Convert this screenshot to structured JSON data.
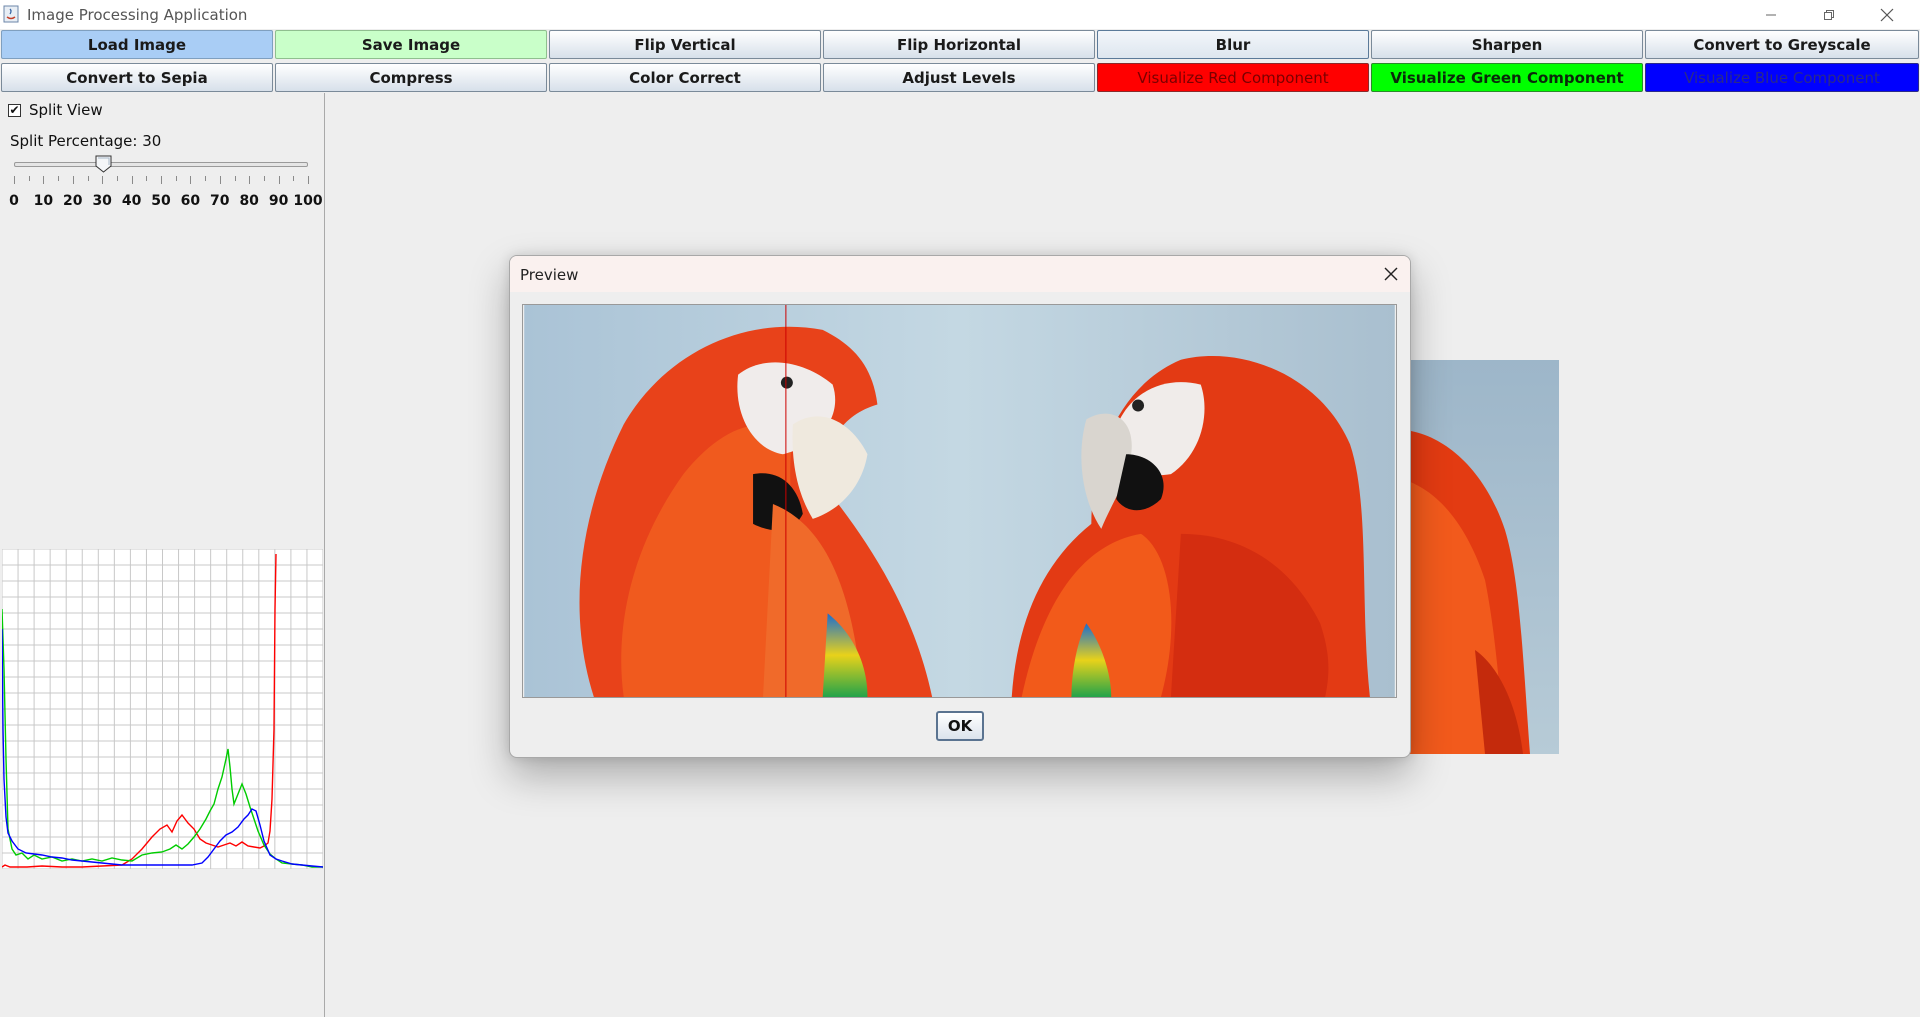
{
  "window": {
    "title": "Image Processing Application",
    "icons": [
      "java-app-icon",
      "minimize-icon",
      "restore-icon",
      "close-icon"
    ]
  },
  "toolbar": {
    "row1": [
      {
        "label": "Load Image",
        "style": "load",
        "color": "#a9cdf5"
      },
      {
        "label": "Save Image",
        "style": "save",
        "color": "#c9ffc9"
      },
      {
        "label": "Flip Vertical",
        "style": "default"
      },
      {
        "label": "Flip Horizontal",
        "style": "default"
      },
      {
        "label": "Blur",
        "style": "selected"
      },
      {
        "label": "Sharpen",
        "style": "default"
      },
      {
        "label": "Convert to Greyscale",
        "style": "default"
      }
    ],
    "row2": [
      {
        "label": "Convert to Sepia",
        "style": "default"
      },
      {
        "label": "Compress",
        "style": "default"
      },
      {
        "label": "Color Correct",
        "style": "default"
      },
      {
        "label": "Adjust Levels",
        "style": "default"
      },
      {
        "label": "Visualize Red Component",
        "style": "red",
        "color": "#ff0000"
      },
      {
        "label": "Visualize Green Component",
        "style": "green",
        "color": "#00ff00"
      },
      {
        "label": "Visualize Blue Component",
        "style": "blue",
        "color": "#0000ff"
      }
    ]
  },
  "left_panel": {
    "split_view": {
      "label": "Split View",
      "checked": true,
      "check_glyph": "✔"
    },
    "split_percentage": {
      "label": "Split Percentage:",
      "value": "30"
    },
    "slider": {
      "value": 30,
      "min": 0,
      "max": 100
    },
    "tick_labels": [
      "0",
      "10",
      "20",
      "30",
      "40",
      "50",
      "60",
      "70",
      "80",
      "90",
      "100"
    ],
    "histogram": {
      "channels": [
        {
          "name": "red",
          "color": "#ff0000"
        },
        {
          "name": "green",
          "color": "#00cc00"
        },
        {
          "name": "blue",
          "color": "#0000ff"
        }
      ]
    }
  },
  "dialog": {
    "title": "Preview",
    "ok_label": "OK",
    "split_line_color": "#cc0000"
  }
}
